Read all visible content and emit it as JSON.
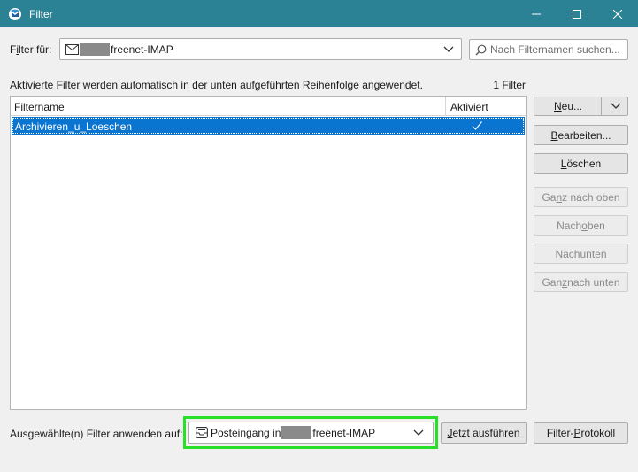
{
  "window": {
    "title": "Filter"
  },
  "filter_for": {
    "label_prefix": "F",
    "label_underlined": "i",
    "label_suffix": "lter für:",
    "account_text": "freenet-IMAP"
  },
  "search": {
    "placeholder": "Nach Filternamen suchen..."
  },
  "info": {
    "description": "Aktivierte Filter werden automatisch in der unten aufgeführten Reihenfolge angewendet.",
    "count": "1 Filter"
  },
  "list": {
    "columns": {
      "name": "Filtername",
      "active": "Aktiviert"
    },
    "rows": [
      {
        "name": "Archivieren_u_Loeschen",
        "active": true
      }
    ]
  },
  "buttons": {
    "new": {
      "underlined": "N",
      "rest": "eu..."
    },
    "edit": {
      "underlined": "B",
      "rest": "earbeiten..."
    },
    "delete": {
      "underlined": "L",
      "rest": "öschen"
    },
    "top": {
      "pre": "Ga",
      "underlined": "n",
      "rest": "z nach oben"
    },
    "up": {
      "pre": "Nach ",
      "underlined": "o",
      "rest": "ben"
    },
    "down": {
      "pre": "Nach ",
      "underlined": "u",
      "rest": "nten"
    },
    "bottom": {
      "pre": "Gan",
      "underlined": "z",
      "rest": " nach unten"
    },
    "run_now": {
      "underlined": "J",
      "rest": "etzt ausführen"
    },
    "log": {
      "pre": "Filter-",
      "underlined": "P",
      "rest": "rotokoll"
    }
  },
  "apply": {
    "label": "Ausgewählte(n) Filter anwenden auf:",
    "folder_prefix": "Posteingang in",
    "folder_suffix": "freenet-IMAP"
  }
}
